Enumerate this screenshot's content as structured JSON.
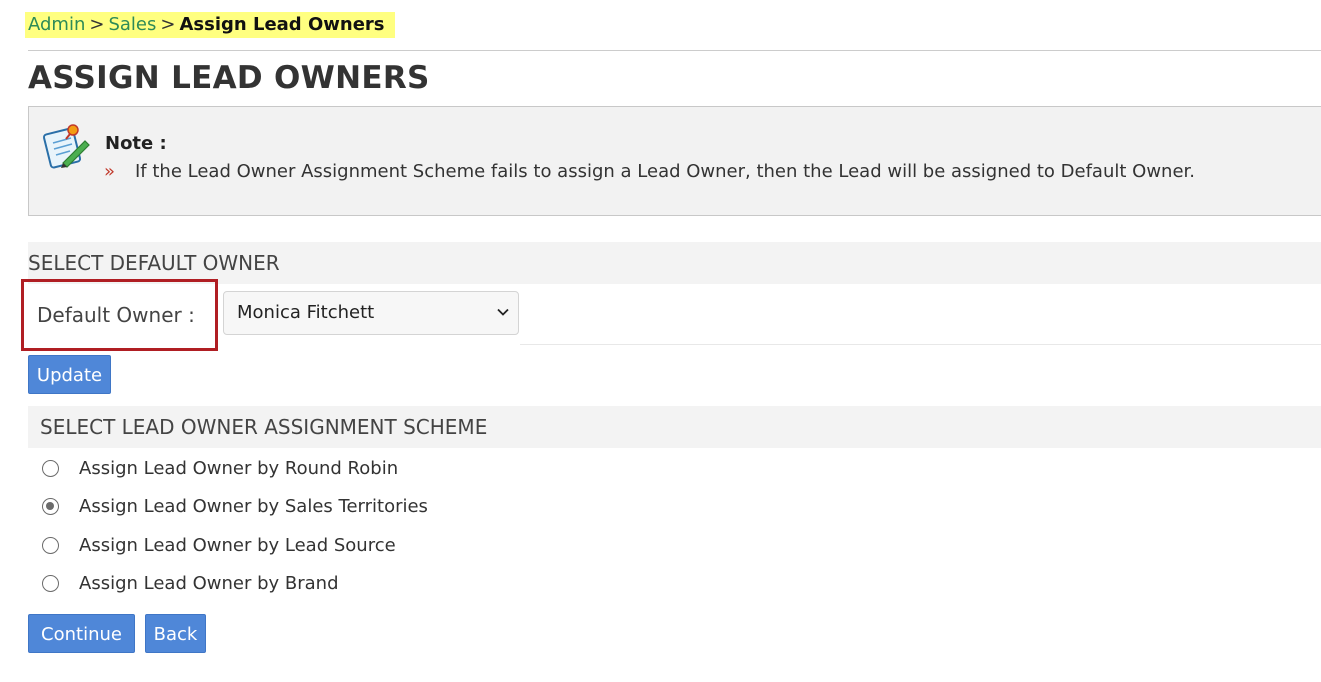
{
  "breadcrumb": {
    "items": [
      "Admin",
      "Sales"
    ],
    "separator": ">",
    "current": "Assign Lead Owners"
  },
  "page_title": "ASSIGN LEAD OWNERS",
  "note": {
    "title": "Note :",
    "bullet": "»",
    "text": "If the Lead Owner Assignment Scheme fails to assign a Lead Owner, then the Lead will be assigned to Default Owner.",
    "icon": "notepad-pushpin-icon"
  },
  "default_owner_section": {
    "header": "SELECT DEFAULT OWNER",
    "label": "Default Owner :",
    "selected": "Monica Fitchett",
    "update_label": "Update"
  },
  "scheme_section": {
    "header": "SELECT LEAD OWNER ASSIGNMENT SCHEME",
    "options": [
      {
        "label": "Assign Lead Owner by Round Robin",
        "checked": false
      },
      {
        "label": "Assign Lead Owner by Sales Territories",
        "checked": true
      },
      {
        "label": "Assign Lead Owner by Lead Source",
        "checked": false
      },
      {
        "label": "Assign Lead Owner by Brand",
        "checked": false
      }
    ]
  },
  "actions": {
    "continue_label": "Continue",
    "back_label": "Back"
  },
  "colors": {
    "breadcrumb_highlight": "#ffff80",
    "link": "#2e8b57",
    "button": "#4f87d8",
    "highlight_border": "#b01e23",
    "bullet": "#c0392b"
  }
}
